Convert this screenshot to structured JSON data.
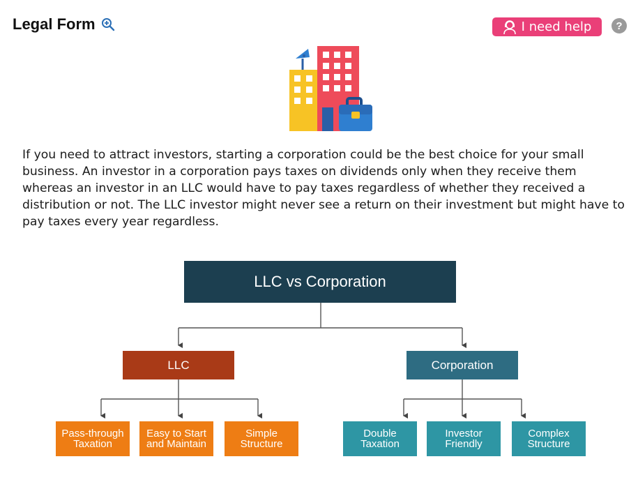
{
  "header": {
    "title": "Legal Form",
    "help_button_label": "I need help",
    "info_label": "?"
  },
  "body_text": "If you need to attract investors, starting a corporation could be the best choice for your small business. An investor in a corporation pays taxes on dividends only when they receive them whereas an investor in an LLC would have to pay taxes regardless of whether they received a distribution or not. The LLC investor might never see a return on their investment but might have to pay taxes every year regardless.",
  "diagram": {
    "root": "LLC vs Corporation",
    "llc": {
      "label": "LLC",
      "items": [
        "Pass-through\nTaxation",
        "Easy to Start\nand Maintain",
        "Simple\nStructure"
      ]
    },
    "corporation": {
      "label": "Corporation",
      "items": [
        "Double\nTaxation",
        "Investor\nFriendly",
        "Complex\nStructure"
      ]
    }
  },
  "colors": {
    "help_button": "#ea3f78",
    "root_box": "#1c3f50",
    "llc_box": "#a93a17",
    "corporation_box": "#2e6c82",
    "llc_leaves": "#ee7d14",
    "corporation_leaves": "#2e96a4"
  },
  "icons": {
    "zoom": "zoom-in-icon",
    "help": "support-agent-icon",
    "info": "question-icon",
    "illustration": "office-buildings-briefcase"
  }
}
